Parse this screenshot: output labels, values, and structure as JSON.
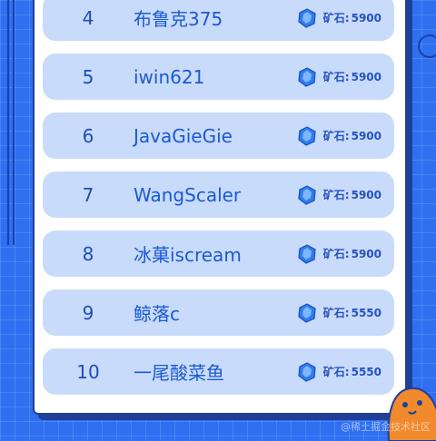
{
  "leaderboard": {
    "rows": [
      {
        "rank": "4",
        "name": "布鲁克375",
        "label": "矿石:",
        "value": "5900"
      },
      {
        "rank": "5",
        "name": "iwin621",
        "label": "矿石:",
        "value": "5900"
      },
      {
        "rank": "6",
        "name": "JavaGieGie",
        "label": "矿石:",
        "value": "5900"
      },
      {
        "rank": "7",
        "name": "WangScaler",
        "label": "矿石:",
        "value": "5900"
      },
      {
        "rank": "8",
        "name": "冰菓iscream",
        "label": "矿石:",
        "value": "5900"
      },
      {
        "rank": "9",
        "name": "鲸落c",
        "label": "矿石:",
        "value": "5550"
      },
      {
        "rank": "10",
        "name": "一尾酸菜鱼",
        "label": "矿石:",
        "value": "5550"
      }
    ]
  },
  "watermark": "@稀土掘金技术社区",
  "icons": {
    "ore": "ore-gem-icon",
    "mascot": "blob-mascot"
  },
  "colors": {
    "background": "#2f6ff0",
    "row": "#c9dbfa",
    "text": "#1a5ad4"
  }
}
